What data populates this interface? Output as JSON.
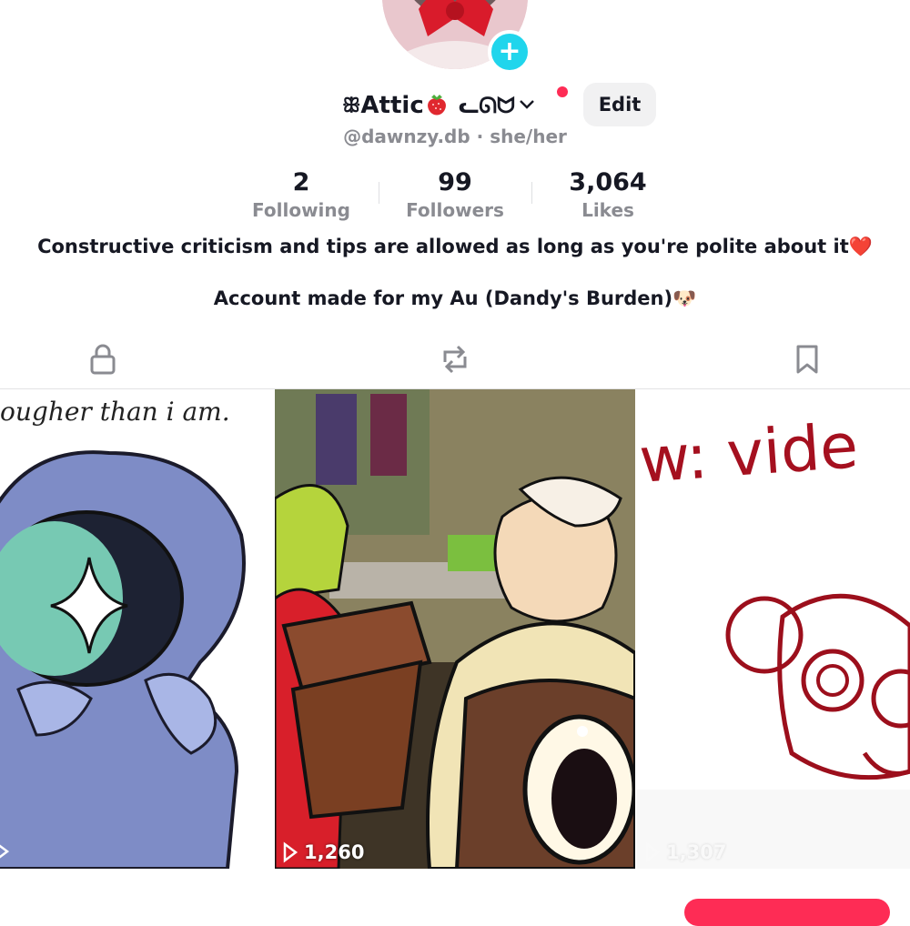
{
  "profile": {
    "name": "Attic",
    "name_suffix": "ᓚᘏᗢ",
    "name_prefix_glyph": "ꕥ",
    "handle": "@dawnzy.db · she/her",
    "edit_label": "Edit",
    "plus_label": "+",
    "icons": [
      "plus-icon",
      "strawberry-icon",
      "chevron-down-icon"
    ]
  },
  "stats": [
    {
      "value": "2",
      "label": "Following"
    },
    {
      "value": "99",
      "label": "Followers"
    },
    {
      "value": "3,064",
      "label": "Likes"
    }
  ],
  "bio": {
    "line1": "Constructive criticism and tips are allowed as long as you're polite about it❤️",
    "line2": "Account made for my Au (Dandy's Burden)🐶"
  },
  "tabs": [
    {
      "name": "lock-icon"
    },
    {
      "name": "repost-icon"
    },
    {
      "name": "bookmark-icon"
    }
  ],
  "videos": [
    {
      "caption": "ougher than i am.",
      "views": ""
    },
    {
      "caption": "",
      "views": "1,260"
    },
    {
      "caption": "w: vide",
      "views": "1,307"
    }
  ],
  "colors": {
    "accent": "#fe2c55",
    "badge": "#20d5ec",
    "muted_text": "#8a8b91"
  }
}
